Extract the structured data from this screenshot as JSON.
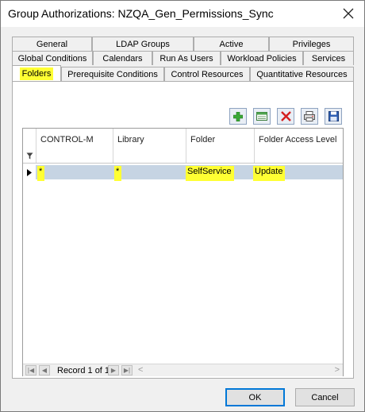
{
  "window": {
    "title": "Group Authorizations: NZQA_Gen_Permissions_Sync"
  },
  "tabs": {
    "row1": [
      "General",
      "LDAP Groups",
      "Active",
      "Privileges"
    ],
    "row2": [
      "Global Conditions",
      "Calendars",
      "Run As Users",
      "Workload Policies",
      "Services"
    ],
    "row3": [
      "Folders",
      "Prerequisite Conditions",
      "Control Resources",
      "Quantitative Resources"
    ],
    "active": "Folders"
  },
  "toolbar": {
    "icons": [
      "add-icon",
      "edit-icon",
      "delete-icon",
      "print-icon",
      "save-icon"
    ]
  },
  "grid": {
    "columns": [
      "CONTROL-M",
      "Library",
      "Folder",
      "Folder Access Level"
    ],
    "rows": [
      {
        "controlm": "*",
        "library": "*",
        "folder": "SelfService",
        "access": "Update"
      }
    ]
  },
  "navigator": {
    "record_text": "Record 1 of 1"
  },
  "buttons": {
    "ok": "OK",
    "cancel": "Cancel"
  },
  "colors": {
    "highlight": "#ffff33",
    "selected_row": "#c6d4e3"
  }
}
